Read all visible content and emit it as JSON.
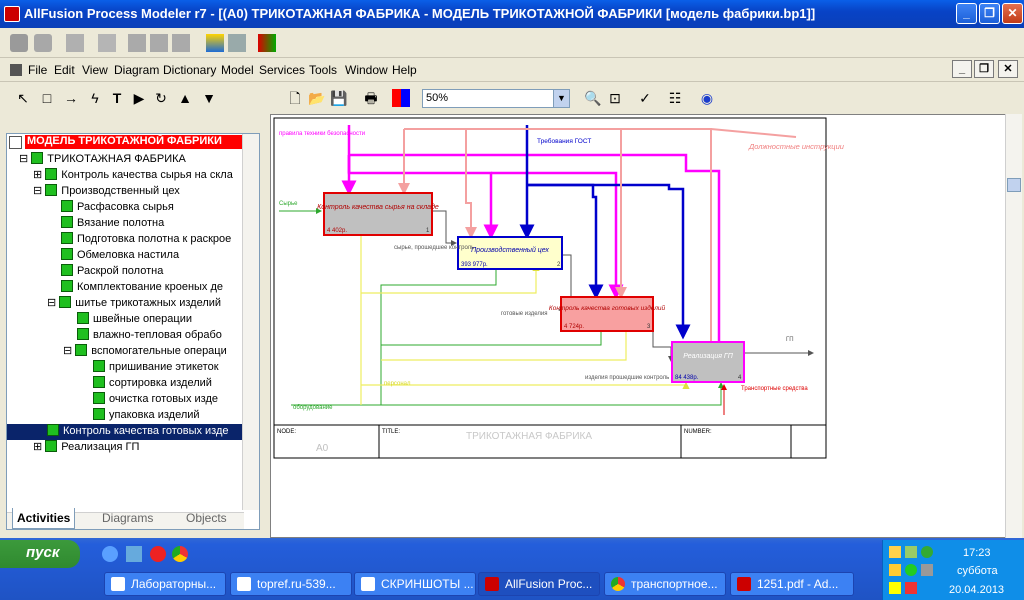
{
  "window": {
    "title": "AllFusion Process Modeler r7 - [(A0) ТРИКОТАЖНАЯ ФАБРИКА - МОДЕЛЬ ТРИКОТАЖНОЙ ФАБРИКИ  [модель фабрики.bp1]]"
  },
  "menu": [
    "File",
    "Edit",
    "View",
    "Diagram",
    "Dictionary",
    "Model",
    "Services",
    "Tools",
    "Window",
    "Help"
  ],
  "zoom": "50%",
  "tree": {
    "root": "МОДЕЛЬ ТРИКОТАЖНОЙ ФАБРИКИ",
    "items": [
      "ТРИКОТАЖНАЯ ФАБРИКА",
      "Контроль качества  сырья на скла",
      "Производственный цех",
      "Расфасовка  сырья",
      "Вязание  полотна",
      "Подготовка  полотна к раскрое",
      "Обмеловка  настила",
      "Раскрой полотна",
      "Комплектование  кроеных   де",
      "шитье  трикотажных изделий",
      "швейные операции",
      "влажно-тепловая      обрабо",
      "вспомогательные  операци",
      "пришивание  этикеток",
      "сортировка  изделий",
      "очистка готовых       изде",
      "упаковка изделий",
      "Контроль качества  готовых изде",
      "Реализация ГП"
    ]
  },
  "tabs": [
    "Activities",
    "Diagrams",
    "Objects"
  ],
  "diagram": {
    "boxes": [
      {
        "label": "Контроль качества сырья на складе",
        "cost": "4 402р.",
        "num": "1"
      },
      {
        "label": "Производственный цех",
        "cost": "393 977р.",
        "num": "2"
      },
      {
        "label": "Контроль качества готовых изделий",
        "cost": "4 724р.",
        "num": "3"
      },
      {
        "label": "Реализация ГП",
        "cost": "84 438р.",
        "num": "4"
      }
    ],
    "arrows": {
      "raw": "Сырье",
      "rules": "правила техники безопасности",
      "gost": "Требования ГОСТ",
      "instr": "Должностные инструкции",
      "passed": "сырье, прошедшее контроль",
      "finished": "готовые изделия",
      "checked": "изделия прошедшие контроль",
      "staff": "персонал",
      "equip": "оборудование",
      "trans": "Транспортные средства",
      "gp": "ГП"
    },
    "frame": {
      "node_label": "NODE:",
      "node": "A0",
      "title_label": "TITLE:",
      "title": "ТРИКОТАЖНАЯ ФАБРИКА",
      "number_label": "NUMBER:"
    }
  },
  "taskbar": {
    "start": "пуск",
    "tasks": [
      "Лабораторны...",
      "topref.ru-539...",
      "СКРИНШОТЫ ...",
      "AllFusion Proc...",
      "транспортное...",
      "1251.pdf - Ad..."
    ],
    "time": "17:23",
    "day": "суббота",
    "date": "20.04.2013"
  },
  "colors": {
    "control": "#ff00ff",
    "gost": "#0000cc",
    "instr": "#f4a0a0",
    "input": "#2ea82e",
    "mech": "#ffff60",
    "box_red": "#e00000",
    "box_fill": "#c0c0c0"
  }
}
